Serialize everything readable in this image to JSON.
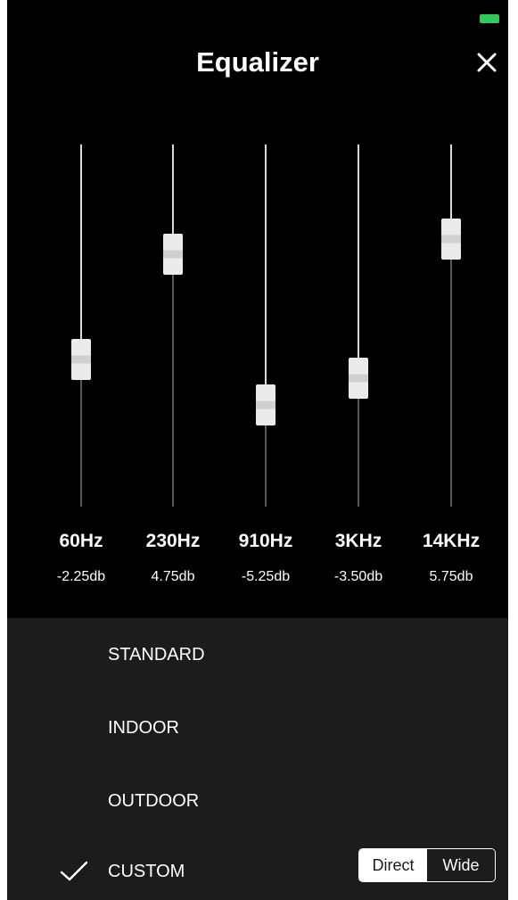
{
  "header": {
    "title": "Equalizer",
    "close_icon": "close-icon",
    "battery_color": "#34c759"
  },
  "bands": [
    {
      "freq": "60Hz",
      "gain_label": "-2.25db",
      "gain": -2.25
    },
    {
      "freq": "230Hz",
      "gain_label": "4.75db",
      "gain": 4.75
    },
    {
      "freq": "910Hz",
      "gain_label": "-5.25db",
      "gain": -5.25
    },
    {
      "freq": "3KHz",
      "gain_label": "-3.50db",
      "gain": -3.5
    },
    {
      "freq": "14KHz",
      "gain_label": "5.75db",
      "gain": 5.75
    }
  ],
  "presets": [
    {
      "label": "STANDARD",
      "selected": false
    },
    {
      "label": "INDOOR",
      "selected": false
    },
    {
      "label": "OUTDOOR",
      "selected": false
    },
    {
      "label": "CUSTOM",
      "selected": true
    }
  ],
  "mode_toggle": {
    "options": [
      "Direct",
      "Wide"
    ],
    "selected": "Direct"
  }
}
